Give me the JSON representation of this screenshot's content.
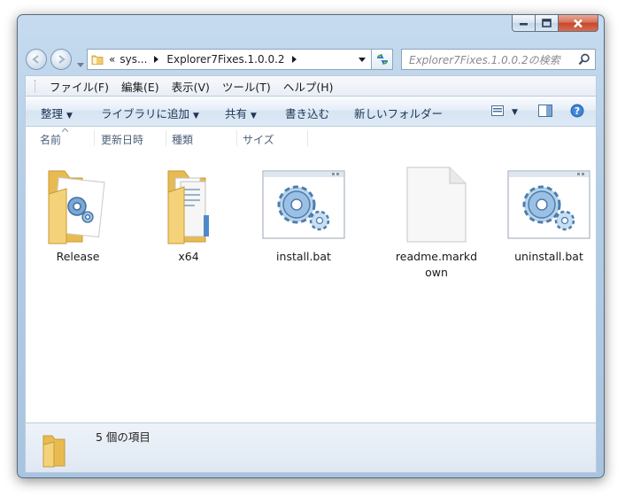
{
  "address": {
    "overflow": "«",
    "segments": [
      "sys...",
      "Explorer7Fixes.1.0.0.2"
    ]
  },
  "search": {
    "placeholder": "Explorer7Fixes.1.0.0.2の検索"
  },
  "menu": [
    "ファイル(F)",
    "編集(E)",
    "表示(V)",
    "ツール(T)",
    "ヘルプ(H)"
  ],
  "toolbar": {
    "organize": "整理",
    "include_library": "ライブラリに追加",
    "share": "共有",
    "burn": "書き込む",
    "new_folder": "新しいフォルダー"
  },
  "columns": [
    "名前",
    "更新日時",
    "種類",
    "サイズ"
  ],
  "files": [
    {
      "name": "Release",
      "icon": "folder-with-gear-icon"
    },
    {
      "name": "x64",
      "icon": "folder-with-documents-icon"
    },
    {
      "name": "install.bat",
      "icon": "batch-file-icon"
    },
    {
      "name": "readme.markdown",
      "icon": "blank-file-icon"
    },
    {
      "name": "uninstall.bat",
      "icon": "batch-file-icon"
    }
  ],
  "status": {
    "item_count": "5 個の項目"
  },
  "colors": {
    "chrome": "#b3cde6",
    "close_button": "#c7472c",
    "folder": "#f3d27a"
  }
}
